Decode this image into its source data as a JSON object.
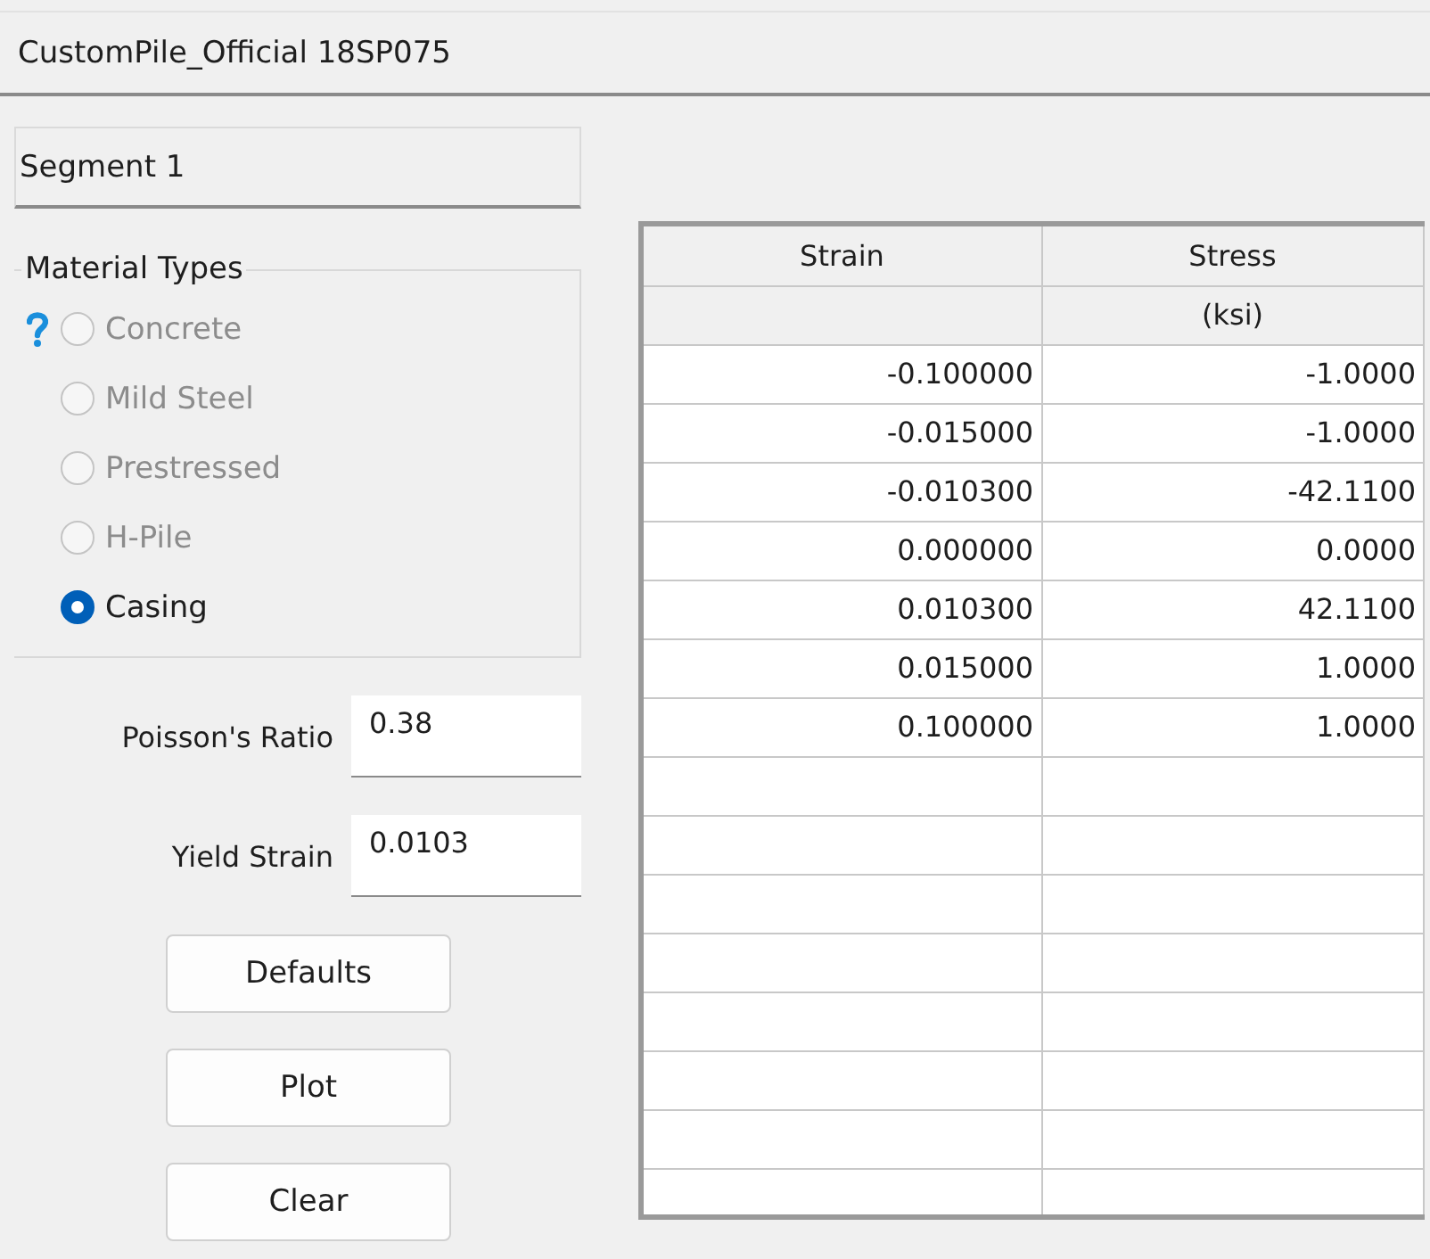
{
  "window": {
    "title": "CustomPile_Official 18SP075"
  },
  "segment": {
    "label": "Segment 1"
  },
  "material_types": {
    "title": "Material Types",
    "options": [
      {
        "label": "Concrete",
        "selected": false,
        "disabled": true
      },
      {
        "label": "Mild Steel",
        "selected": false,
        "disabled": true
      },
      {
        "label": "Prestressed",
        "selected": false,
        "disabled": true
      },
      {
        "label": "H-Pile",
        "selected": false,
        "disabled": true
      },
      {
        "label": "Casing",
        "selected": true,
        "disabled": false
      }
    ]
  },
  "fields": [
    {
      "label": "Poisson's Ratio",
      "value": "0.38"
    },
    {
      "label": "Yield Strain",
      "value": "0.0103"
    }
  ],
  "buttons": [
    "Defaults",
    "Plot",
    "Clear"
  ],
  "table": {
    "columns": [
      {
        "name": "Strain"
      },
      {
        "name": "Stress",
        "unit": "(ksi)"
      }
    ],
    "rows": [
      [
        "-0.100000",
        "-1.0000"
      ],
      [
        "-0.015000",
        "-1.0000"
      ],
      [
        "-0.010300",
        "-42.1100"
      ],
      [
        "0.000000",
        "0.0000"
      ],
      [
        "0.010300",
        "42.1100"
      ],
      [
        "0.015000",
        "1.0000"
      ],
      [
        "0.100000",
        "1.0000"
      ]
    ]
  }
}
